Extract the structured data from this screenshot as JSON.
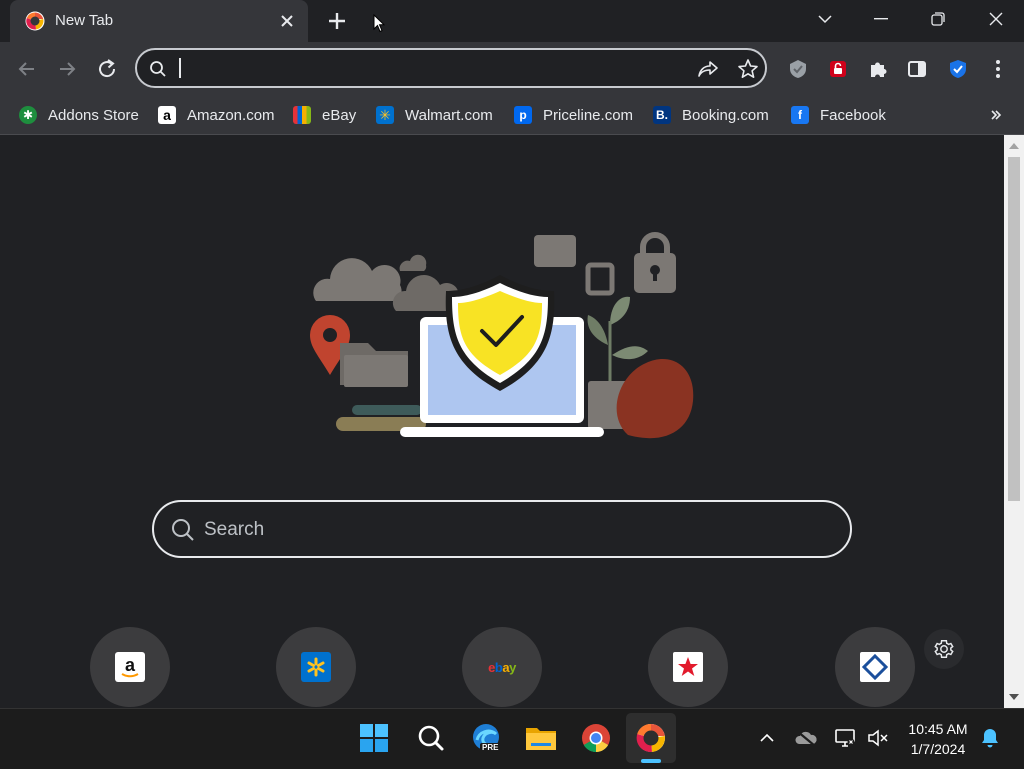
{
  "tab": {
    "title": "New Tab"
  },
  "omnibox": {
    "value": "",
    "placeholder": ""
  },
  "bookmarks": [
    {
      "label": "Addons Store",
      "icon": "addons-store-icon",
      "color": "#1e8e3e"
    },
    {
      "label": "Amazon.com",
      "icon": "amazon-icon",
      "color": "#ffffff"
    },
    {
      "label": "eBay",
      "icon": "ebay-icon",
      "color": "#e53238"
    },
    {
      "label": "Walmart.com",
      "icon": "walmart-icon",
      "color": "#0071ce"
    },
    {
      "label": "Priceline.com",
      "icon": "priceline-icon",
      "color": "#0068ef"
    },
    {
      "label": "Booking.com",
      "icon": "booking-icon",
      "color": "#003580"
    },
    {
      "label": "Facebook",
      "icon": "facebook-icon",
      "color": "#1877f2"
    }
  ],
  "search": {
    "placeholder": "Search"
  },
  "tiles": [
    {
      "name": "amazon",
      "icon": "amazon-logo"
    },
    {
      "name": "walmart",
      "icon": "walmart-logo"
    },
    {
      "name": "ebay",
      "icon": "ebay-logo",
      "text": "ebay"
    },
    {
      "name": "macys",
      "icon": "macys-star-logo"
    },
    {
      "name": "diamond",
      "icon": "diamond-logo"
    }
  ],
  "taskbar": {
    "time": "10:45 AM",
    "date": "1/7/2024",
    "edge_badge": "PRE"
  },
  "colors": {
    "page_bg": "#202124",
    "toolbar_bg": "#35363a",
    "shield_yellow": "#f8e324",
    "accent_blue": "#4cc2ff"
  }
}
